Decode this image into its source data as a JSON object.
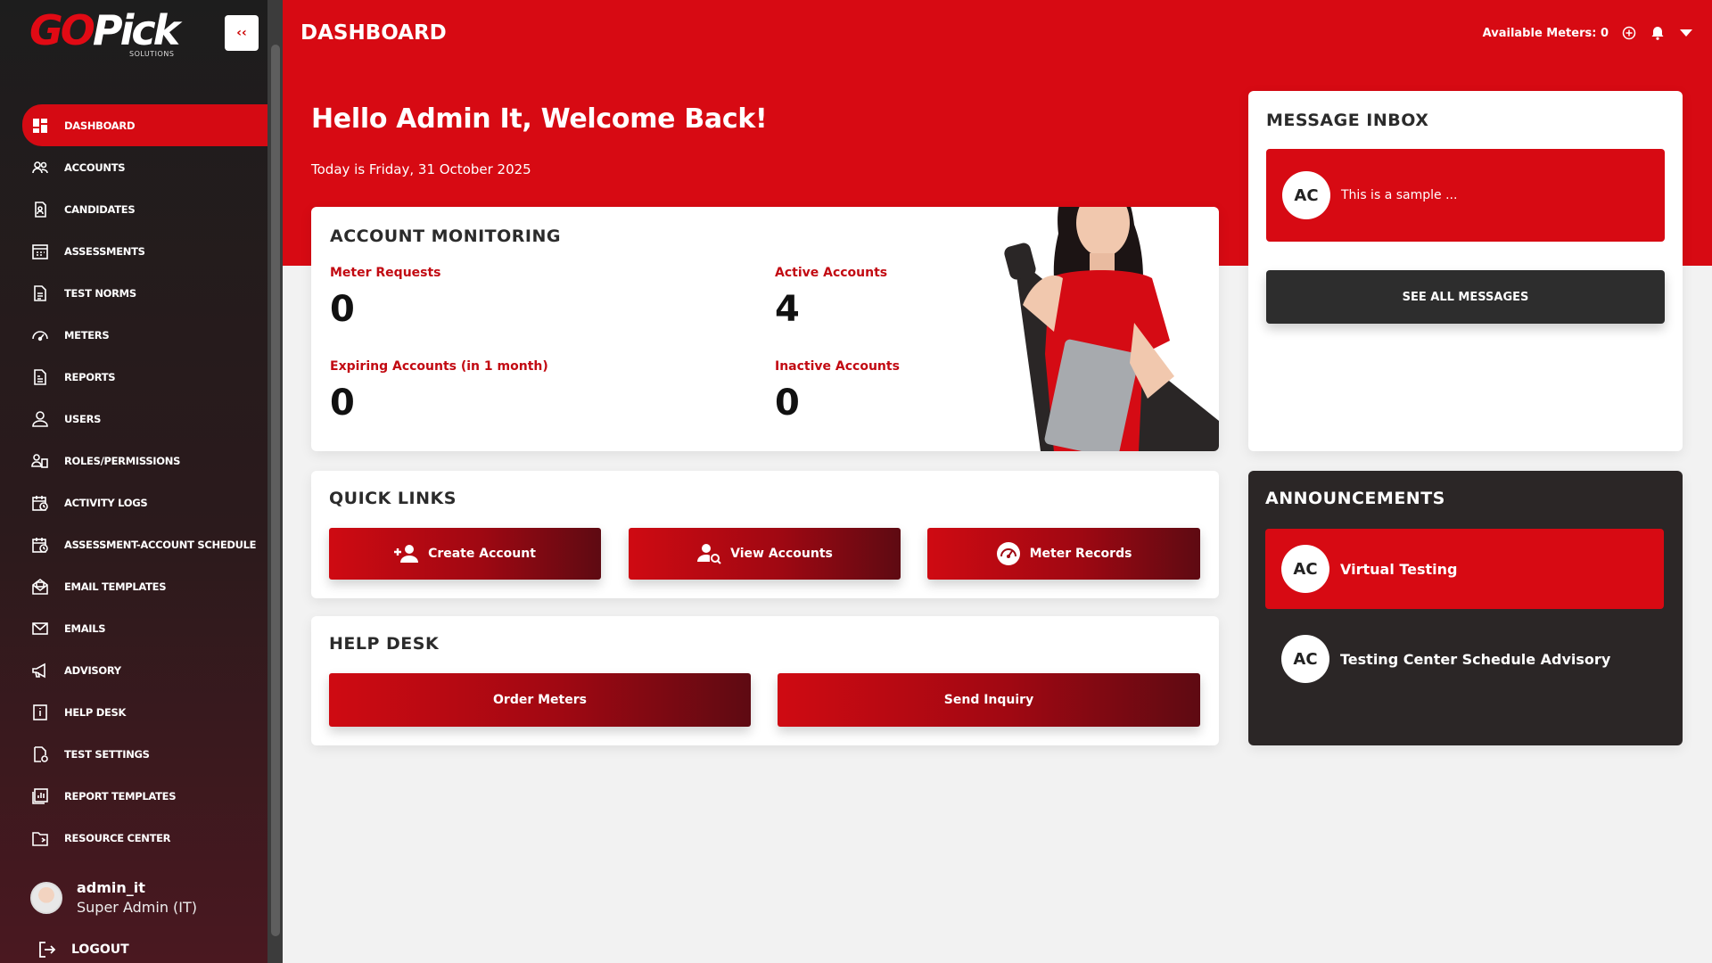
{
  "brand": {
    "logo_go": "GO",
    "logo_pick": "Pick",
    "logo_sub": "SOLUTIONS",
    "collapse_label": "‹‹"
  },
  "sidebar": {
    "items": [
      {
        "label": "DASHBOARD",
        "icon": "dashboard-icon"
      },
      {
        "label": "ACCOUNTS",
        "icon": "users-icon"
      },
      {
        "label": "CANDIDATES",
        "icon": "candidates-icon"
      },
      {
        "label": "ASSESSMENTS",
        "icon": "calendar-icon"
      },
      {
        "label": "TEST NORMS",
        "icon": "document-icon"
      },
      {
        "label": "METERS",
        "icon": "gauge-icon"
      },
      {
        "label": "REPORTS",
        "icon": "report-icon"
      },
      {
        "label": "USERS",
        "icon": "user-icon"
      },
      {
        "label": "ROLES/PERMISSIONS",
        "icon": "roles-icon"
      },
      {
        "label": "ACTIVITY LOGS",
        "icon": "activity-icon"
      },
      {
        "label": "ASSESSMENT-ACCOUNT SCHEDULE",
        "icon": "schedule-icon"
      },
      {
        "label": "EMAIL TEMPLATES",
        "icon": "email-template-icon"
      },
      {
        "label": "EMAILS",
        "icon": "mail-icon"
      },
      {
        "label": "ADVISORY",
        "icon": "megaphone-icon"
      },
      {
        "label": "HELP DESK",
        "icon": "info-icon"
      },
      {
        "label": "TEST SETTINGS",
        "icon": "settings-doc-icon"
      },
      {
        "label": "REPORT TEMPLATES",
        "icon": "chart-icon"
      },
      {
        "label": "RESOURCE CENTER",
        "icon": "folder-icon"
      }
    ],
    "user": {
      "name": "admin_it",
      "role": "Super Admin (IT)"
    },
    "logout_label": "LOGOUT"
  },
  "header": {
    "title": "DASHBOARD",
    "available_meters": "Available Meters: 0"
  },
  "hero": {
    "welcome": "Hello Admin It, Welcome Back!",
    "today": "Today is Friday, 31 October 2025"
  },
  "account_monitoring": {
    "title": "ACCOUNT MONITORING",
    "meter_requests_label": "Meter Requests",
    "meter_requests_value": "0",
    "active_accounts_label": "Active Accounts",
    "active_accounts_value": "4",
    "expiring_label": "Expiring Accounts (in 1 month)",
    "expiring_value": "0",
    "inactive_label": "Inactive Accounts",
    "inactive_value": "0"
  },
  "inbox": {
    "title": "MESSAGE INBOX",
    "messages": [
      {
        "initials": "AC",
        "preview": "This is a sample ..."
      }
    ],
    "see_all": "SEE ALL MESSAGES"
  },
  "quick_links": {
    "title": "QUICK LINKS",
    "create_account": "Create Account",
    "view_accounts": "View Accounts",
    "meter_records": "Meter Records"
  },
  "help_desk": {
    "title": "HELP DESK",
    "order_meters": "Order Meters",
    "send_inquiry": "Send Inquiry"
  },
  "announcements": {
    "title": "ANNOUNCEMENTS",
    "items": [
      {
        "initials": "AC",
        "label": "Virtual Testing"
      },
      {
        "initials": "AC",
        "label": "Testing Center Schedule Advisory"
      }
    ]
  },
  "colors": {
    "brand_red": "#d70a13",
    "dark": "#2b2626",
    "sidebar": "#1d1d1d"
  }
}
